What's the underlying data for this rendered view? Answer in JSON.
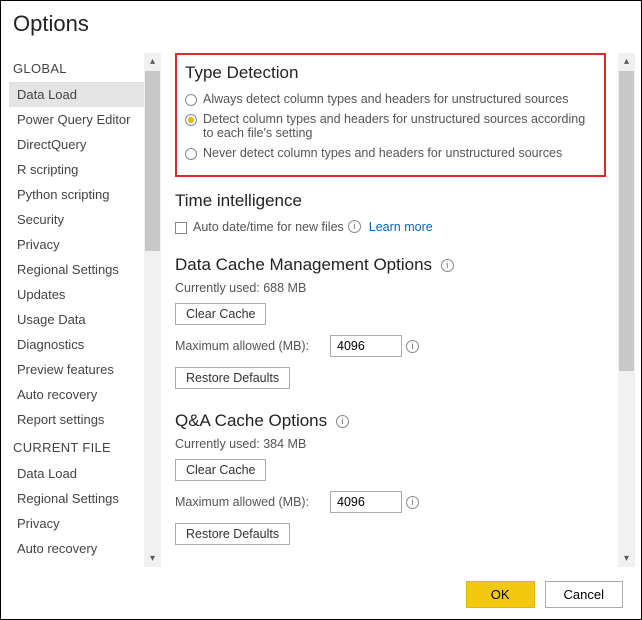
{
  "dialog": {
    "title": "Options"
  },
  "sidebar": {
    "sections": [
      {
        "header": "GLOBAL",
        "items": [
          "Data Load",
          "Power Query Editor",
          "DirectQuery",
          "R scripting",
          "Python scripting",
          "Security",
          "Privacy",
          "Regional Settings",
          "Updates",
          "Usage Data",
          "Diagnostics",
          "Preview features",
          "Auto recovery",
          "Report settings"
        ]
      },
      {
        "header": "CURRENT FILE",
        "items": [
          "Data Load",
          "Regional Settings",
          "Privacy",
          "Auto recovery"
        ]
      }
    ],
    "selected": "Data Load"
  },
  "main": {
    "type_detection": {
      "title": "Type Detection",
      "options": [
        "Always detect column types and headers for unstructured sources",
        "Detect column types and headers for unstructured sources according to each file's setting",
        "Never detect column types and headers for unstructured sources"
      ],
      "selected_index": 1
    },
    "time_intelligence": {
      "title": "Time intelligence",
      "checkbox_label": "Auto date/time for new files",
      "learn_more": "Learn more"
    },
    "data_cache": {
      "title": "Data Cache Management Options",
      "currently_used_label": "Currently used: 688 MB",
      "clear_button": "Clear Cache",
      "max_label": "Maximum allowed (MB):",
      "max_value": "4096",
      "restore_button": "Restore Defaults"
    },
    "qa_cache": {
      "title": "Q&A Cache Options",
      "currently_used_label": "Currently used: 384 MB",
      "clear_button": "Clear Cache",
      "max_label": "Maximum allowed (MB):",
      "max_value": "4096",
      "restore_button": "Restore Defaults"
    }
  },
  "footer": {
    "ok": "OK",
    "cancel": "Cancel"
  }
}
